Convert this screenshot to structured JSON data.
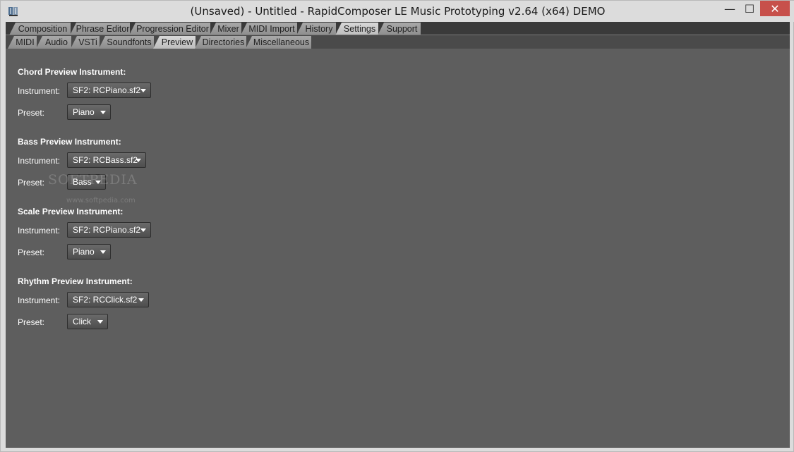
{
  "window": {
    "title": "(Unsaved) - Untitled - RapidComposer LE Music Prototyping v2.64 (x64) DEMO",
    "minimize": "—",
    "maximize": "☐",
    "close": "✕"
  },
  "main_tabs": [
    {
      "label": "Composition"
    },
    {
      "label": "Phrase Editor"
    },
    {
      "label": "Progression Editor"
    },
    {
      "label": "Mixer"
    },
    {
      "label": "MIDI Import"
    },
    {
      "label": "History"
    },
    {
      "label": "Settings"
    },
    {
      "label": "Support"
    }
  ],
  "sub_tabs": [
    {
      "label": "MIDI"
    },
    {
      "label": "Audio"
    },
    {
      "label": "VSTi"
    },
    {
      "label": "Soundfonts"
    },
    {
      "label": "Preview"
    },
    {
      "label": "Directories"
    },
    {
      "label": "Miscellaneous"
    }
  ],
  "labels": {
    "instrument": "Instrument:",
    "preset": "Preset:"
  },
  "sections": [
    {
      "title": "Chord Preview Instrument:",
      "instrument": "SF2: RCPiano.sf2",
      "preset": "Piano"
    },
    {
      "title": "Bass Preview Instrument:",
      "instrument": "SF2: RCBass.sf2",
      "preset": "Bass"
    },
    {
      "title": "Scale Preview Instrument:",
      "instrument": "SF2: RCPiano.sf2",
      "preset": "Piano"
    },
    {
      "title": "Rhythm Preview Instrument:",
      "instrument": "SF2: RCClick.sf2",
      "preset": "Click"
    }
  ],
  "watermark": {
    "text": "SOFTPEDIA",
    "url": "www.softpedia.com"
  },
  "colors": {
    "panel": "#5e5e5e",
    "active_tab": "#cfcfcf",
    "close_button": "#c7504b"
  }
}
